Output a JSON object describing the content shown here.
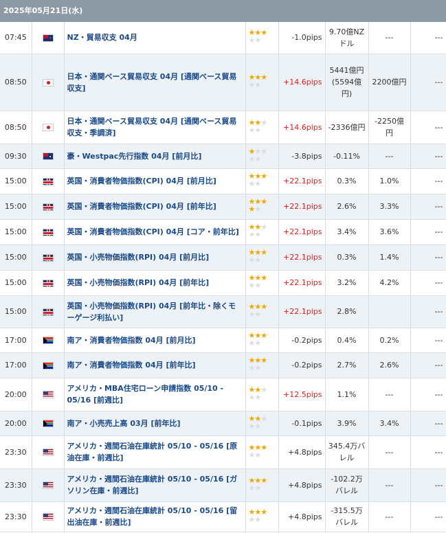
{
  "date_header": "2025年05月21日(水)",
  "rows": [
    {
      "time": "07:45",
      "flag": "nz",
      "flag_icon": "nz-flag-icon",
      "name": "NZ・貿易収支 04月",
      "stars": 3,
      "pips": "-1.0pips",
      "pips_up": false,
      "prev": "9.70億NZドル",
      "forecast": "---",
      "result": "---"
    },
    {
      "time": "08:50",
      "flag": "jp",
      "flag_icon": "jp-flag-icon",
      "name": "日本・通関ベース貿易収支 04月 [通関ベース貿易収支]",
      "stars": 3,
      "pips": "+14.6pips",
      "pips_up": true,
      "prev": "5441億円(5594億円)",
      "forecast": "2200億円",
      "result": "---"
    },
    {
      "time": "08:50",
      "flag": "jp",
      "flag_icon": "jp-flag-icon",
      "name": "日本・通関ベース貿易収支 04月 [通関ベース貿易収支・季調済]",
      "stars": 2,
      "pips": "+14.6pips",
      "pips_up": true,
      "prev": "-2336億円",
      "forecast": "-2250億円",
      "result": "---"
    },
    {
      "time": "09:30",
      "flag": "au",
      "flag_icon": "au-flag-icon",
      "name": "豪・Westpac先行指数 04月 [前月比]",
      "stars": 1,
      "pips": "-3.8pips",
      "pips_up": false,
      "prev": "-0.11%",
      "forecast": "---",
      "result": "---"
    },
    {
      "time": "15:00",
      "flag": "gb",
      "flag_icon": "gb-flag-icon",
      "name": "英国・消費者物価指数(CPI) 04月 [前月比]",
      "stars": 3,
      "pips": "+22.1pips",
      "pips_up": true,
      "prev": "0.3%",
      "forecast": "1.0%",
      "result": "---"
    },
    {
      "time": "15:00",
      "flag": "gb",
      "flag_icon": "gb-flag-icon",
      "name": "英国・消費者物価指数(CPI) 04月 [前年比]",
      "stars": 4,
      "pips": "+22.1pips",
      "pips_up": true,
      "prev": "2.6%",
      "forecast": "3.3%",
      "result": "---"
    },
    {
      "time": "15:00",
      "flag": "gb",
      "flag_icon": "gb-flag-icon",
      "name": "英国・消費者物価指数(CPI) 04月 [コア・前年比]",
      "stars": 2,
      "pips": "+22.1pips",
      "pips_up": true,
      "prev": "3.4%",
      "forecast": "3.6%",
      "result": "---"
    },
    {
      "time": "15:00",
      "flag": "gb",
      "flag_icon": "gb-flag-icon",
      "name": "英国・小売物価指数(RPI) 04月 [前月比]",
      "stars": 3,
      "pips": "+22.1pips",
      "pips_up": true,
      "prev": "0.3%",
      "forecast": "1.4%",
      "result": "---"
    },
    {
      "time": "15:00",
      "flag": "gb",
      "flag_icon": "gb-flag-icon",
      "name": "英国・小売物価指数(RPI) 04月 [前年比]",
      "stars": 3,
      "pips": "+22.1pips",
      "pips_up": true,
      "prev": "3.2%",
      "forecast": "4.2%",
      "result": "---"
    },
    {
      "time": "15:00",
      "flag": "gb",
      "flag_icon": "gb-flag-icon",
      "name": "英国・小売物価指数(RPI) 04月 [前年比・除くモーゲージ利払い]",
      "stars": 3,
      "pips": "+22.1pips",
      "pips_up": true,
      "prev": "2.8%",
      "forecast": "",
      "result": "---"
    },
    {
      "time": "17:00",
      "flag": "za",
      "flag_icon": "za-flag-icon",
      "name": "南ア・消費者物価指数 04月 [前月比]",
      "stars": 3,
      "pips": "-0.2pips",
      "pips_up": false,
      "prev": "0.4%",
      "forecast": "0.2%",
      "result": "---"
    },
    {
      "time": "17:00",
      "flag": "za",
      "flag_icon": "za-flag-icon",
      "name": "南ア・消費者物価指数 04月 [前年比]",
      "stars": 3,
      "pips": "-0.2pips",
      "pips_up": false,
      "prev": "2.7%",
      "forecast": "2.6%",
      "result": "---"
    },
    {
      "time": "20:00",
      "flag": "us",
      "flag_icon": "us-flag-icon",
      "name": "アメリカ・MBA住宅ローン申請指数 05/10 - 05/16 [前週比]",
      "stars": 2,
      "pips": "+12.5pips",
      "pips_up": true,
      "prev": "1.1%",
      "forecast": "---",
      "result": "---"
    },
    {
      "time": "20:00",
      "flag": "za",
      "flag_icon": "za-flag-icon",
      "name": "南ア・小売売上高 03月 [前年比]",
      "stars": 2,
      "pips": "-0.1pips",
      "pips_up": false,
      "prev": "3.9%",
      "forecast": "3.4%",
      "result": "---"
    },
    {
      "time": "23:30",
      "flag": "us",
      "flag_icon": "us-flag-icon",
      "name": "アメリカ・週間石油在庫統計 05/10 - 05/16 [原油在庫・前週比]",
      "stars": 3,
      "pips": "+4.8pips",
      "pips_up": false,
      "prev": "345.4万バレル",
      "forecast": "---",
      "result": "---"
    },
    {
      "time": "23:30",
      "flag": "us",
      "flag_icon": "us-flag-icon",
      "name": "アメリカ・週間石油在庫統計 05/10 - 05/16 [ガソリン在庫・前週比]",
      "stars": 3,
      "pips": "+4.8pips",
      "pips_up": false,
      "prev": "-102.2万バレル",
      "forecast": "---",
      "result": "---"
    },
    {
      "time": "23:30",
      "flag": "us",
      "flag_icon": "us-flag-icon",
      "name": "アメリカ・週間石油在庫統計 05/10 - 05/16 [留出油在庫・前週比]",
      "stars": 3,
      "pips": "+4.8pips",
      "pips_up": false,
      "prev": "-315.5万バレル",
      "forecast": "---",
      "result": "---"
    }
  ],
  "row_heights": [
    46,
    83,
    48,
    36,
    37,
    37,
    37,
    37,
    37,
    47,
    36,
    37,
    48,
    36,
    48,
    48,
    44
  ],
  "colors": {
    "header_bg": "#8c9aa6",
    "link": "#1a4a8a",
    "pips_up": "#e0201a",
    "star": "#f2a600",
    "row_alt": "#edf2f6"
  }
}
